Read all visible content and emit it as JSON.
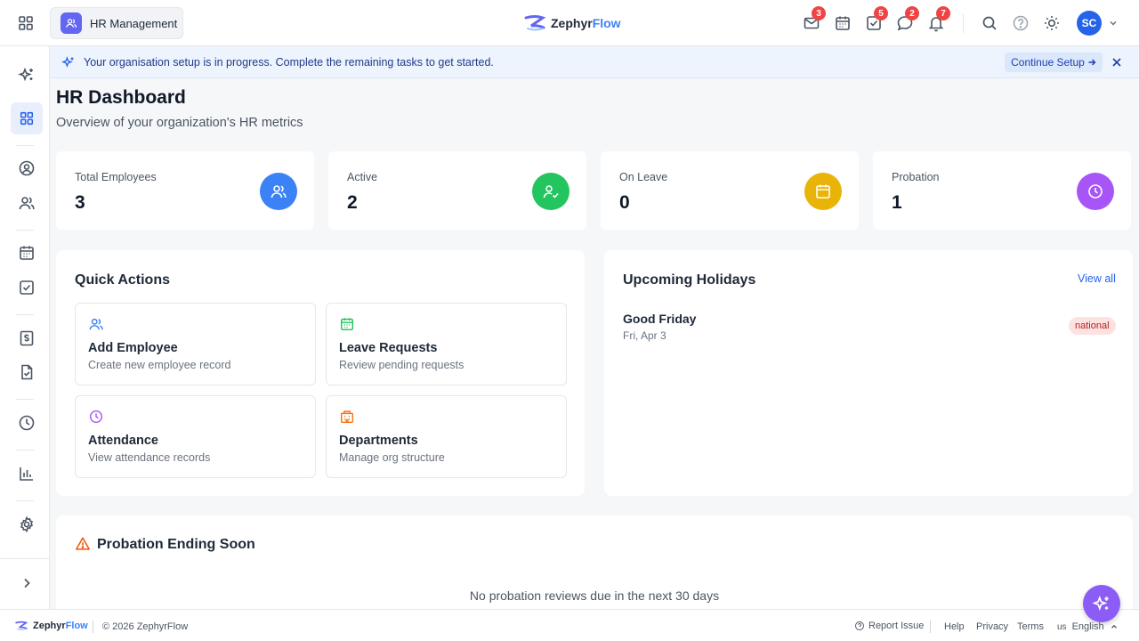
{
  "topbar": {
    "module_label": "HR Management",
    "logo_prefix": "Zephyr",
    "logo_suffix": "Flow",
    "badges": {
      "mail": "3",
      "tasks": "5",
      "chat": "2",
      "notifications": "7"
    },
    "avatar_initials": "SC"
  },
  "banner": {
    "text": "Your organisation setup is in progress. Complete the remaining tasks to get started.",
    "button_label": "Continue Setup"
  },
  "page": {
    "title": "HR Dashboard",
    "subtitle": "Overview of your organization's HR metrics"
  },
  "stats": [
    {
      "label": "Total Employees",
      "value": "3",
      "color": "#3b82f6",
      "icon": "users-icon"
    },
    {
      "label": "Active",
      "value": "2",
      "color": "#22c55e",
      "icon": "user-check-icon"
    },
    {
      "label": "On Leave",
      "value": "0",
      "color": "#eab308",
      "icon": "calendar-icon"
    },
    {
      "label": "Probation",
      "value": "1",
      "color": "#a855f7",
      "icon": "clock-icon"
    }
  ],
  "quick_actions": {
    "title": "Quick Actions",
    "items": [
      {
        "title": "Add Employee",
        "desc": "Create new employee record",
        "icon": "users-icon",
        "color": "#3b82f6"
      },
      {
        "title": "Leave Requests",
        "desc": "Review pending requests",
        "icon": "calendar-icon",
        "color": "#22c55e"
      },
      {
        "title": "Attendance",
        "desc": "View attendance records",
        "icon": "clock-icon",
        "color": "#a855f7"
      },
      {
        "title": "Departments",
        "desc": "Manage org structure",
        "icon": "building-icon",
        "color": "#f97316"
      }
    ]
  },
  "holidays": {
    "title": "Upcoming Holidays",
    "view_all": "View all",
    "items": [
      {
        "name": "Good Friday",
        "date": "Fri, Apr 3",
        "type": "national"
      }
    ]
  },
  "probation": {
    "title": "Probation Ending Soon",
    "empty": "No probation reviews due in the next 30 days"
  },
  "footer": {
    "logo_prefix": "Zephyr",
    "logo_suffix": "Flow",
    "copyright": "© 2026 ZephyrFlow",
    "report": "Report Issue",
    "help": "Help",
    "privacy": "Privacy",
    "terms": "Terms",
    "lang_code": "us",
    "lang": "English"
  }
}
